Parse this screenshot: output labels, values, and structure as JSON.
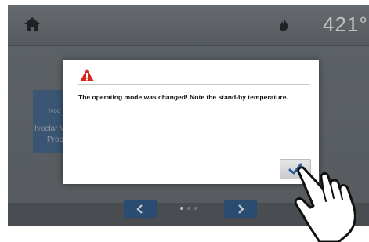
{
  "topbar": {
    "home_icon": "home-icon",
    "flame_icon": "flame-icon",
    "temperature": "421°"
  },
  "background_tile": {
    "line1": "Ivoc",
    "line2": "Ivoclar V",
    "line3": "Prog"
  },
  "dialog": {
    "warning_icon": "warning-triangle-icon",
    "message": "The operating mode was changed! Note the stand-by temperature.",
    "confirm_icon": "checkmark-icon"
  },
  "navigation": {
    "prev_icon": "chevron-left-icon",
    "next_icon": "chevron-right-icon",
    "page_count": 3,
    "active_page": 1
  },
  "colors": {
    "screen_bg": "#6f7478",
    "nav_button": "#2b5787",
    "warning_red": "#d9261c",
    "confirm_check": "#2b5b93",
    "tile_blue": "#2f5f93"
  },
  "pointer_icon": "pointing-hand-icon"
}
